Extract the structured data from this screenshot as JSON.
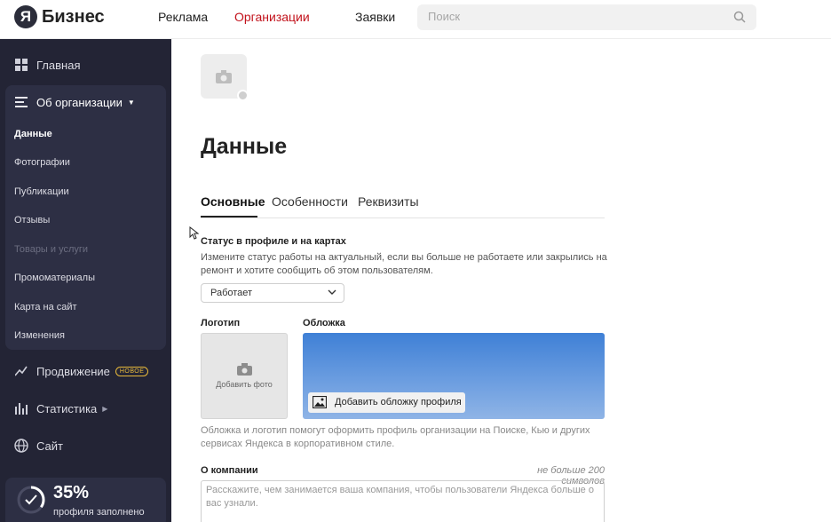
{
  "header": {
    "logo_letter": "Я",
    "logo_text": "Бизнес",
    "nav": [
      "Реклама",
      "Организации",
      "Заявки"
    ],
    "active_nav": "Организации",
    "search_placeholder": "Поиск",
    "accent_color": "#c2121b"
  },
  "sidebar": {
    "home": "Главная",
    "about": "Об организации",
    "about_items": [
      "Данные",
      "Фотографии",
      "Публикации",
      "Отзывы",
      "Товары и услуги",
      "Промоматериалы",
      "Карта на сайт",
      "Изменения"
    ],
    "active_item": "Данные",
    "disabled_item": "Товары и услуги",
    "promo": "Продвижение",
    "promo_badge": "НОВОЕ",
    "stats": "Статистика",
    "site": "Сайт",
    "progress_percent": "35%",
    "progress_label": "профиля заполнено",
    "progress_value": 0.35
  },
  "main": {
    "title": "Данные",
    "tabs": [
      "Основные",
      "Особенности",
      "Реквизиты"
    ],
    "active_tab": "Основные",
    "status_label": "Статус в профиле и на картах",
    "status_hint_1": "Измените статус работы на актуальный, если вы больше не работаете или закрылись на",
    "status_hint_2": "ремонт и хотите сообщить об этом пользователям.",
    "status_value": "Работает",
    "logo_label": "Логотип",
    "add_photo": "Добавить фото",
    "cover_label": "Обложка",
    "add_cover": "Добавить обложку профиля",
    "cover_hint_1": "Обложка и логотип помогут оформить профиль организации на Поиске, Кью и других",
    "cover_hint_2": "сервисах Яндекса в корпоративном стиле.",
    "about_label": "О компании",
    "about_limit": "не больше 200 символов",
    "about_placeholder": "Расскажите, чем занимается ваша компания, чтобы пользователи Яндекса больше о вас узнали."
  }
}
